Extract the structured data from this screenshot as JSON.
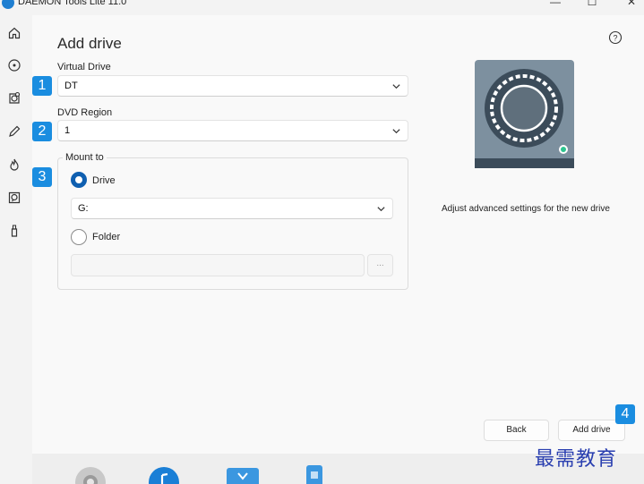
{
  "window": {
    "title": "DAEMON Tools Lite 11.0",
    "minimize_glyph": "—",
    "maximize_glyph": "☐",
    "close_glyph": "✕"
  },
  "sidebar": {
    "items": [
      {
        "name": "home",
        "icon": "home-icon"
      },
      {
        "name": "images",
        "icon": "disc-icon"
      },
      {
        "name": "image-editor",
        "icon": "disc-add-icon"
      },
      {
        "name": "burning",
        "icon": "pencil-icon"
      },
      {
        "name": "write",
        "icon": "flame-icon"
      },
      {
        "name": "virtual-hdd",
        "icon": "disc-search-icon"
      },
      {
        "name": "usb",
        "icon": "usb-icon"
      }
    ]
  },
  "page": {
    "title": "Add drive",
    "help_glyph": "?"
  },
  "form": {
    "virtual_drive": {
      "label": "Virtual Drive",
      "value": "DT",
      "badge": "1"
    },
    "dvd_region": {
      "label": "DVD Region",
      "value": "1",
      "badge": "2"
    },
    "mount_to": {
      "label": "Mount to",
      "badge": "3",
      "drive_option": {
        "label": "Drive",
        "selected": true
      },
      "drive_select": {
        "value": "G:"
      },
      "folder_option": {
        "label": "Folder",
        "selected": false
      },
      "folder_path": {
        "value": "",
        "browse_label": "..."
      }
    }
  },
  "info": {
    "description": "Adjust advanced settings for the new drive"
  },
  "footer": {
    "back_label": "Back",
    "add_label": "Add drive",
    "badge": "4"
  },
  "watermark": "最需教育",
  "colors": {
    "accent": "#0f5fb0",
    "badge": "#1a8de0",
    "drive_art_dark": "#3c4c5a",
    "drive_art_light": "#7d909f",
    "status_dot": "#2ec48f"
  }
}
